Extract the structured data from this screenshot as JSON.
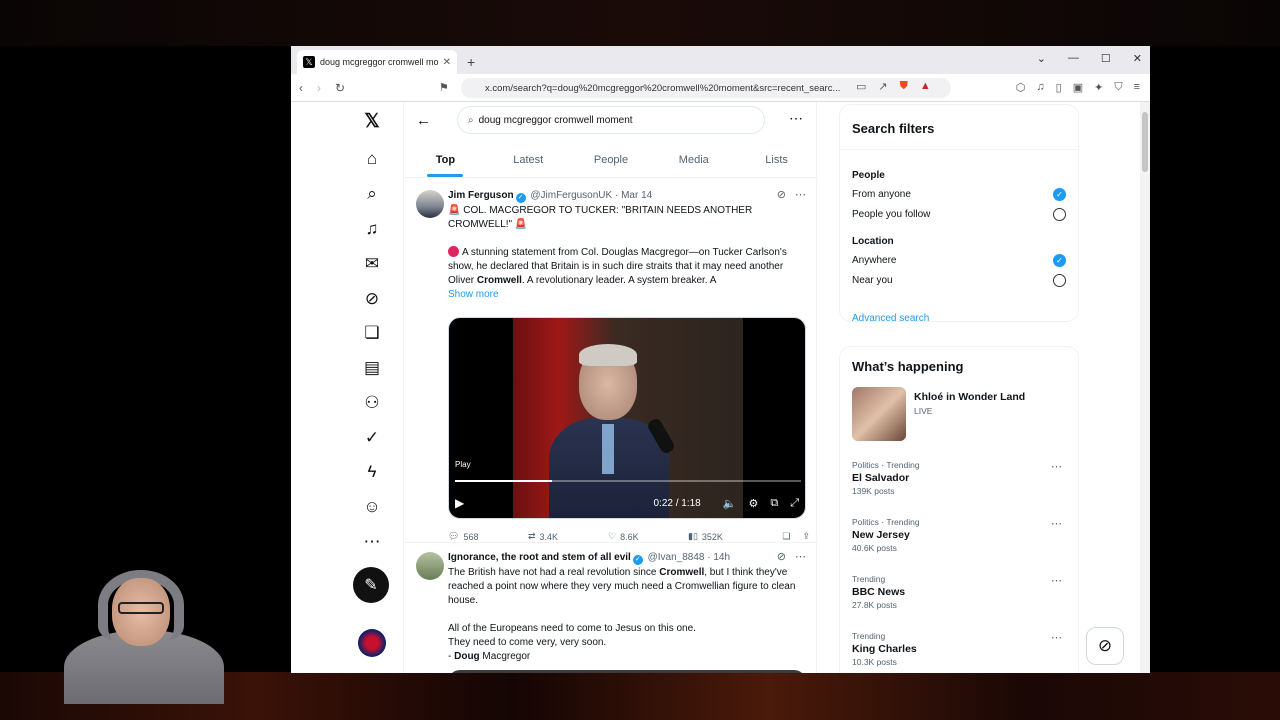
{
  "browser": {
    "tab_title": "doug mcgreggor cromwell mom",
    "url": "x.com/search?q=doug%20mcgreggor%20cromwell%20moment&src=recent_searc..."
  },
  "search": {
    "query": "doug mcgreggor cromwell moment",
    "tabs": [
      "Top",
      "Latest",
      "People",
      "Media",
      "Lists"
    ],
    "active_tab": "Top"
  },
  "tweet1": {
    "name": "Jim Ferguson",
    "handle": "@JimFergusonUK",
    "date": "Mar 14",
    "headline": "COL. MACGREGOR TO TUCKER: \"BRITAIN NEEDS ANOTHER CROMWELL!\"",
    "body_pre": "A stunning statement from Col. Douglas Macgregor—on Tucker Carlson's show, he declared that Britain is in such dire straits that it may need another Oliver ",
    "body_bold": "Cromwell",
    "body_post": ". A revolutionary leader. A system breaker. A",
    "show_more": "Show more",
    "video": {
      "play_label": "Play",
      "time": "0:22 / 1:18",
      "progress": 0.28
    },
    "replies": "568",
    "reposts": "3.4K",
    "likes": "8.6K",
    "views": "352K"
  },
  "tweet2": {
    "name": "Ignorance, the root and stem of all evil",
    "handle": "@Ivan_8848",
    "date": "14h",
    "line1_pre": "The British have not had a real revolution since ",
    "line1_bold": "Cromwell",
    "line1_post": ", but I think they've reached a point now where they very much need a Cromwellian figure to clean house.",
    "line2": "All of the Europeans need to come to Jesus on this one.",
    "line3": "They need to come very, very soon.",
    "sig_bold": "Doug",
    "sig_rest": " Macgregor"
  },
  "filters": {
    "title": "Search filters",
    "people_label": "People",
    "from_anyone": "From anyone",
    "people_you_follow": "People you follow",
    "location_label": "Location",
    "anywhere": "Anywhere",
    "near_you": "Near you",
    "advanced": "Advanced search"
  },
  "happening": {
    "title": "What’s happening",
    "featured": {
      "title": "Khloé in Wonder Land",
      "status": "LIVE"
    },
    "trends": [
      {
        "category": "Politics · Trending",
        "title": "El Salvador",
        "count": "139K posts"
      },
      {
        "category": "Politics · Trending",
        "title": "New Jersey",
        "count": "40.6K posts"
      },
      {
        "category": "Trending",
        "title": "BBC News",
        "count": "27.8K posts"
      },
      {
        "category": "Trending",
        "title": "King Charles",
        "count": "10.3K posts"
      }
    ]
  },
  "colors": {
    "accent": "#1d9bf0",
    "text": "#0f1419",
    "muted": "#536471"
  }
}
